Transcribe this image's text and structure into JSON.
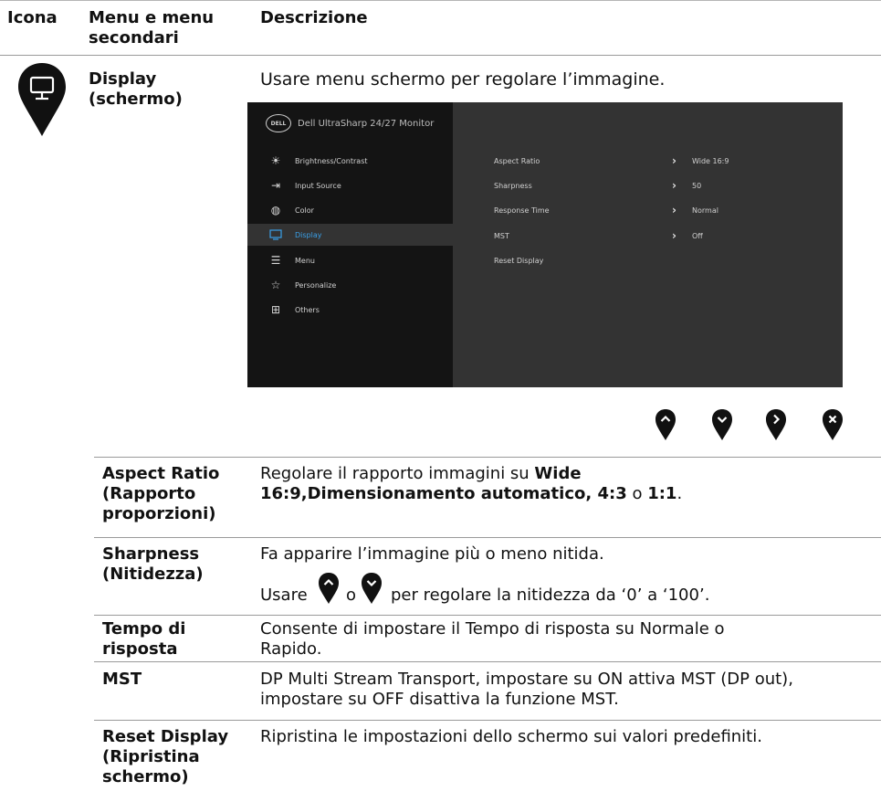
{
  "header": {
    "col_icon": "Icona",
    "col_menu": "Menu e menu secondari",
    "col_desc": "Descrizione"
  },
  "display_entry": {
    "name": "Display (schermo)",
    "description": "Usare menu schermo per regolare l’immagine."
  },
  "osd": {
    "title": "Dell UltraSharp 24/27 Monitor",
    "logo_text": "DELL",
    "menu": [
      {
        "label": "Brightness/Contrast",
        "icon": "sun-icon"
      },
      {
        "label": "Input Source",
        "icon": "input-source-icon"
      },
      {
        "label": "Color",
        "icon": "color-palette-icon"
      },
      {
        "label": "Display",
        "icon": "monitor-icon",
        "selected": true
      },
      {
        "label": "Menu",
        "icon": "menu-list-icon"
      },
      {
        "label": "Personalize",
        "icon": "star-icon"
      },
      {
        "label": "Others",
        "icon": "others-icon"
      }
    ],
    "settings": [
      {
        "name": "Aspect Ratio",
        "value": "Wide 16:9"
      },
      {
        "name": "Sharpness",
        "value": "50"
      },
      {
        "name": "Response Time",
        "value": "Normal"
      },
      {
        "name": "MST",
        "value": "Off"
      },
      {
        "name": "Reset Display",
        "value": ""
      }
    ],
    "colors": {
      "left_panel": "#141414",
      "right_panel": "#333333",
      "accent": "#3aa0e8"
    }
  },
  "nav_buttons": [
    "up-button-icon",
    "down-button-icon",
    "right-button-icon",
    "close-button-icon"
  ],
  "rows": {
    "aspect": {
      "name": "Aspect Ratio (Rapporto proporzioni)",
      "desc_pre": "Regolare il rapporto immagini su ",
      "desc_b1": "Wide 16:9,Dimensionamento automatico, 4:3",
      "desc_mid": " o ",
      "desc_b2": "1:1",
      "desc_end": "."
    },
    "sharpness": {
      "name": "Sharpness (Nitidezza)",
      "desc1": "Fa apparire l’immagine più o meno nitida.",
      "desc2_pre": "Usare",
      "desc2_mid": "o",
      "desc2_post": "per regolare la nitidezza da ‘0’ a ‘100’."
    },
    "response": {
      "name": "Tempo di risposta",
      "desc": "Consente di impostare il Tempo di risposta su Normale o Rapido."
    },
    "mst": {
      "name": "MST",
      "desc": "DP Multi Stream Transport, impostare su ON attiva MST (DP out), impostare su OFF disattiva la funzione MST."
    },
    "reset": {
      "name": "Reset Display (Ripristina schermo)",
      "desc": "Ripristina le impostazioni dello schermo sui valori predefiniti."
    }
  }
}
